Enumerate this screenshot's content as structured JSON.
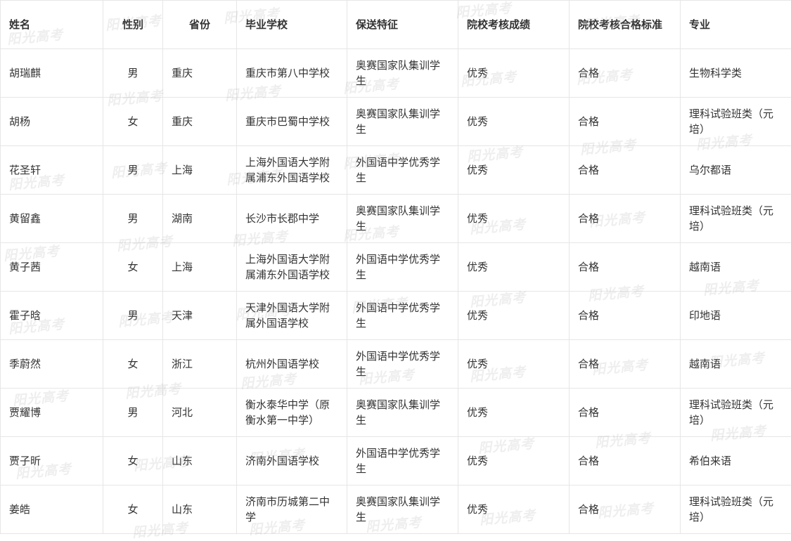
{
  "table": {
    "headers": [
      "姓名",
      "性别",
      "省份",
      "毕业学校",
      "保送特征",
      "院校考核成绩",
      "院校考核合格标准",
      "专业"
    ],
    "rows": [
      [
        "胡瑞麒",
        "男",
        "重庆",
        "重庆市第八中学校",
        "奥赛国家队集训学生",
        "优秀",
        "合格",
        "生物科学类"
      ],
      [
        "胡杨",
        "女",
        "重庆",
        "重庆市巴蜀中学校",
        "奥赛国家队集训学生",
        "优秀",
        "合格",
        "理科试验班类（元培）"
      ],
      [
        "花圣轩",
        "男",
        "上海",
        "上海外国语大学附属浦东外国语学校",
        "外国语中学优秀学生",
        "优秀",
        "合格",
        "乌尔都语"
      ],
      [
        "黄留鑫",
        "男",
        "湖南",
        "长沙市长郡中学",
        "奥赛国家队集训学生",
        "优秀",
        "合格",
        "理科试验班类（元培）"
      ],
      [
        "黄子茜",
        "女",
        "上海",
        "上海外国语大学附属浦东外国语学校",
        "外国语中学优秀学生",
        "优秀",
        "合格",
        "越南语"
      ],
      [
        "霍子晗",
        "男",
        "天津",
        "天津外国语大学附属外国语学校",
        "外国语中学优秀学生",
        "优秀",
        "合格",
        "印地语"
      ],
      [
        "季蔚然",
        "女",
        "浙江",
        "杭州外国语学校",
        "外国语中学优秀学生",
        "优秀",
        "合格",
        "越南语"
      ],
      [
        "贾耀博",
        "男",
        "河北",
        "衡水泰华中学（原衡水第一中学）",
        "奥赛国家队集训学生",
        "优秀",
        "合格",
        "理科试验班类（元培）"
      ],
      [
        "贾子昕",
        "女",
        "山东",
        "济南外国语学校",
        "外国语中学优秀学生",
        "优秀",
        "合格",
        "希伯来语"
      ],
      [
        "姜皓",
        "女",
        "山东",
        "济南市历城第二中学",
        "奥赛国家队集训学生",
        "优秀",
        "合格",
        "理科试验班类（元培）"
      ]
    ]
  },
  "watermark": "阳光高考"
}
